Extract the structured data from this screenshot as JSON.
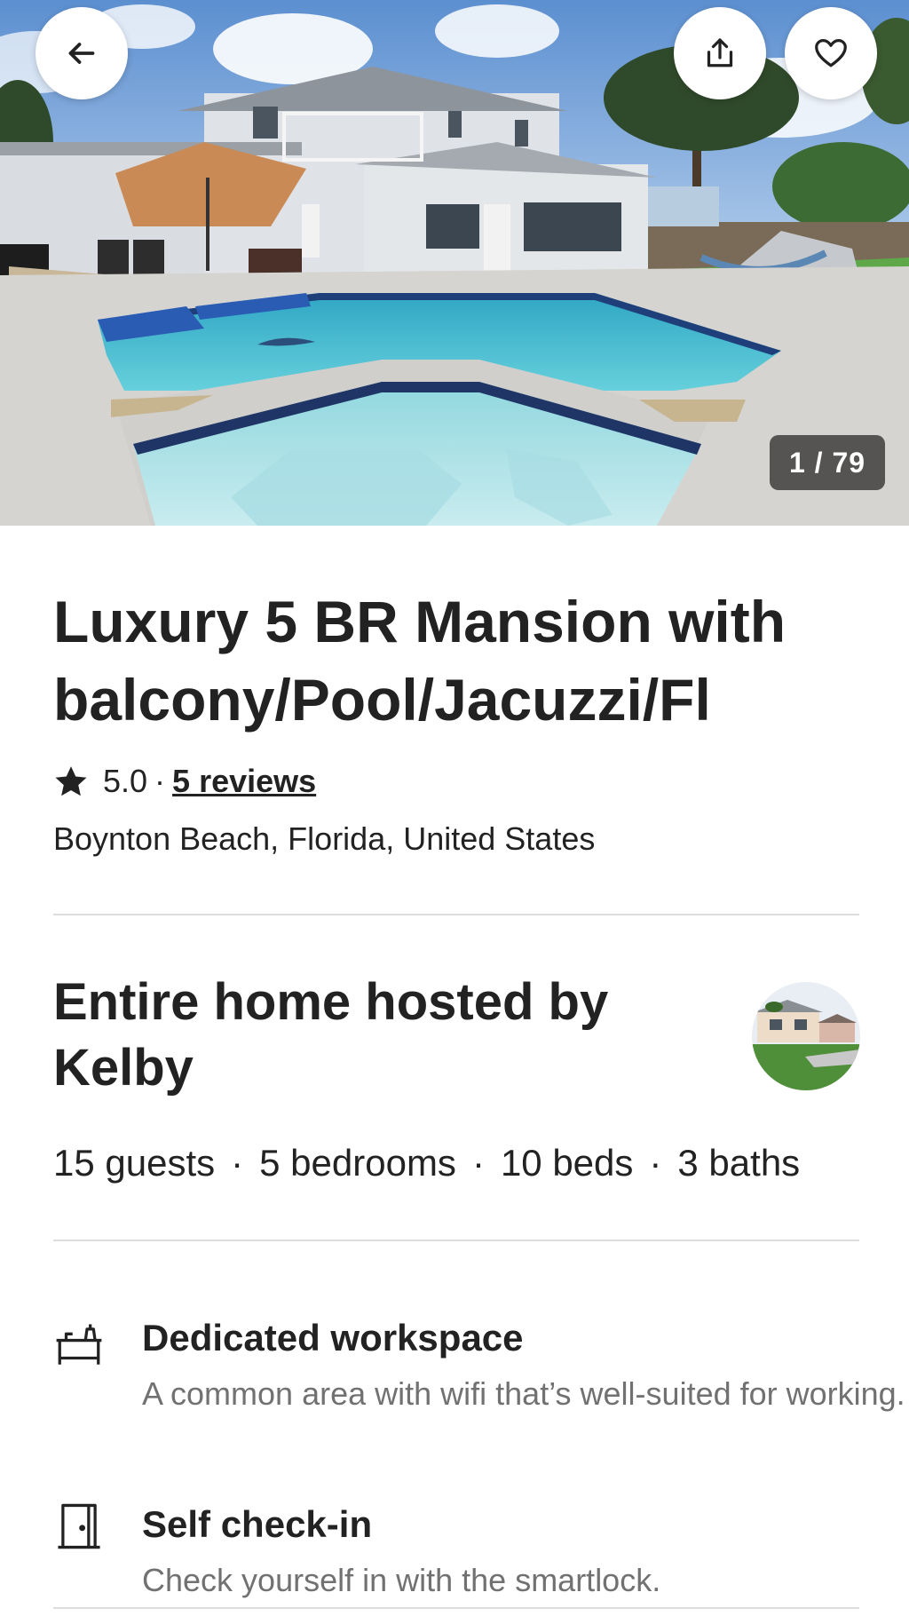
{
  "hero": {
    "photo_counter": "1 / 79"
  },
  "header_actions": {
    "back_icon": "arrow-left-icon",
    "share_icon": "share-icon",
    "favorite_icon": "heart-icon"
  },
  "listing": {
    "title": "Luxury 5 BR Mansion with balcony/Pool/Jacuzzi/Fl",
    "rating": "5.0",
    "rating_separator": "·",
    "reviews_link": "5 reviews",
    "location": "Boynton Beach, Florida, United States"
  },
  "host": {
    "title": "Entire home hosted by Kelby"
  },
  "details": {
    "items": [
      "15 guests",
      "5 bedrooms",
      "10 beds",
      "3 baths"
    ],
    "separator": "·"
  },
  "features": [
    {
      "icon": "desk-icon",
      "title": "Dedicated workspace",
      "description": "A common area with wifi that’s well-suited for working."
    },
    {
      "icon": "door-icon",
      "title": "Self check-in",
      "description": "Check yourself in with the smartlock."
    }
  ],
  "colors": {
    "text_primary": "#222222",
    "text_secondary": "#717171",
    "divider": "#dddddd",
    "pool_water": "#3fb6c9",
    "sky": "#6f9fd8"
  }
}
